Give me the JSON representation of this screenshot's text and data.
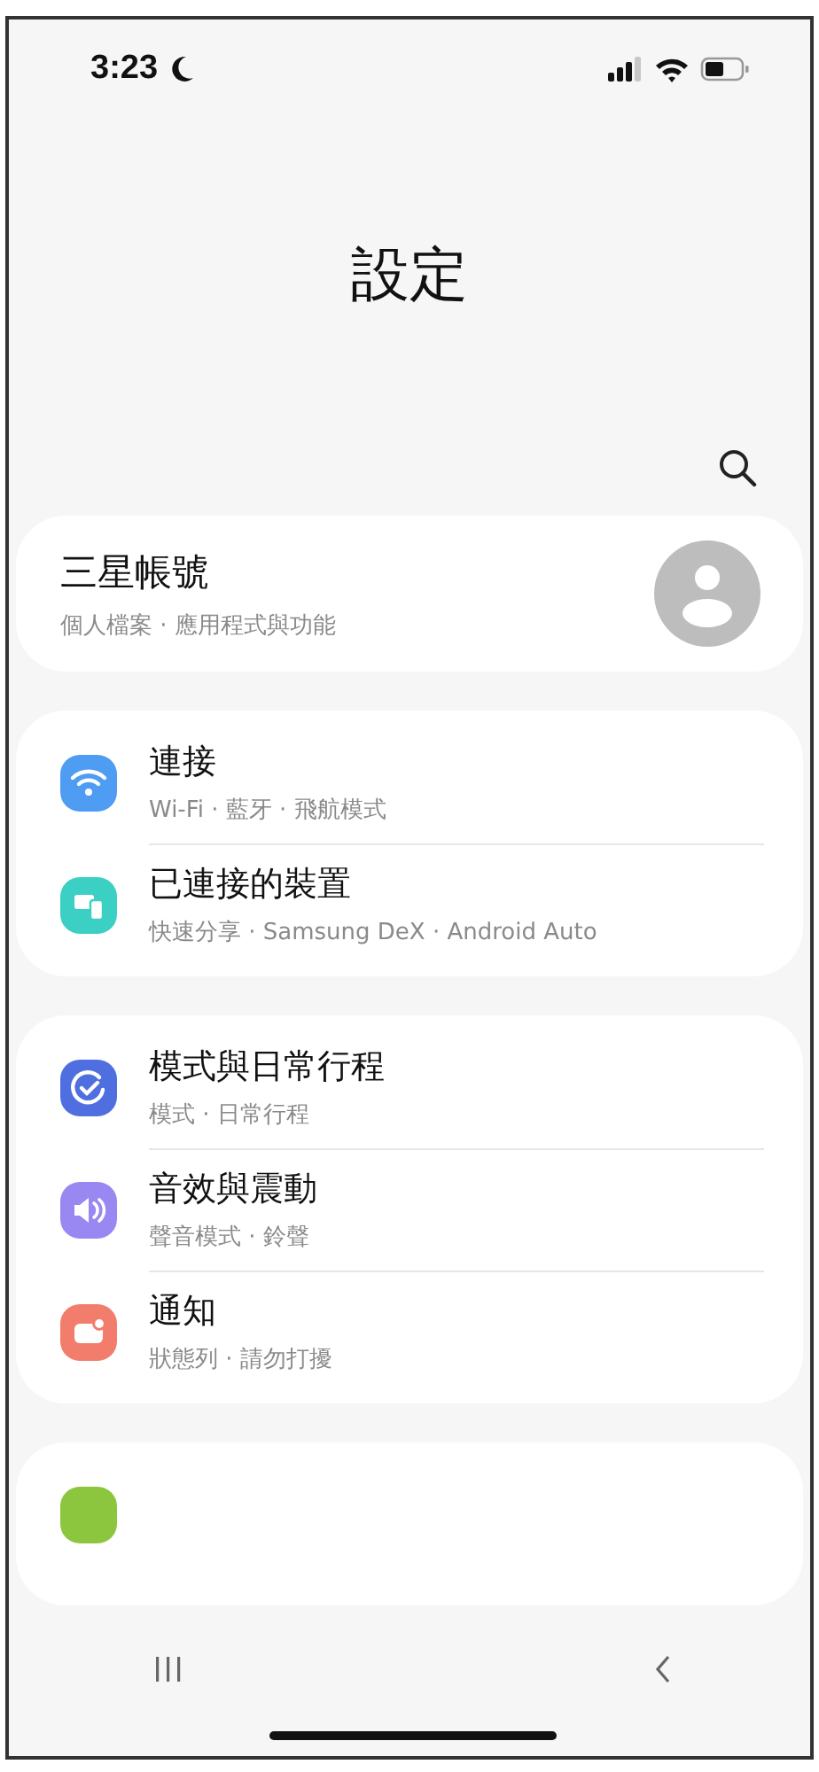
{
  "status_bar": {
    "time": "3:23"
  },
  "title": "設定",
  "account": {
    "name": "三星帳號",
    "subtitle": "個人檔案 · 應用程式與功能"
  },
  "groups": [
    {
      "items": [
        {
          "kind": "wifi",
          "color": "#4f9cf3",
          "title": "連接",
          "subtitle": "Wi-Fi · 藍牙 · 飛航模式"
        },
        {
          "kind": "devices",
          "color": "#3ccfc4",
          "title": "已連接的裝置",
          "subtitle": "快速分享 · Samsung DeX · Android Auto"
        }
      ]
    },
    {
      "items": [
        {
          "kind": "routine",
          "color": "#4f6fe0",
          "title": "模式與日常行程",
          "subtitle": "模式 · 日常行程"
        },
        {
          "kind": "sound",
          "color": "#9a88f2",
          "title": "音效與震動",
          "subtitle": "聲音模式 · 鈴聲"
        },
        {
          "kind": "notification",
          "color": "#f27d6c",
          "title": "通知",
          "subtitle": "狀態列 · 請勿打擾"
        }
      ]
    },
    {
      "items": [
        {
          "kind": "display",
          "color": "#8cc63e"
        }
      ]
    }
  ]
}
